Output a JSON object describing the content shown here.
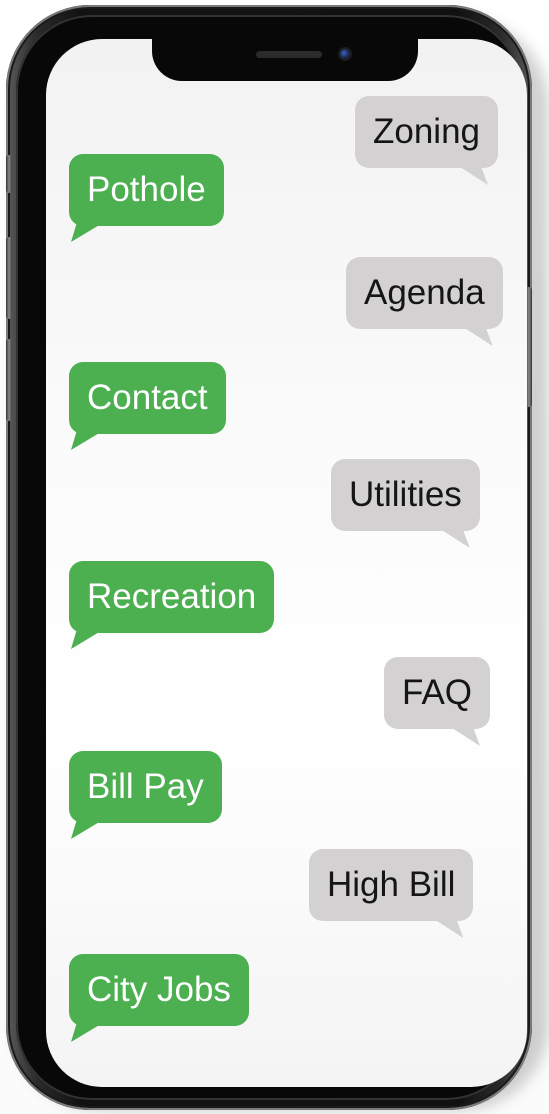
{
  "messages": {
    "zoning": "Zoning",
    "pothole": "Pothole",
    "agenda": "Agenda",
    "contact": "Contact",
    "utilities": "Utilities",
    "recreation": "Recreation",
    "faq": "FAQ",
    "bill_pay": "Bill Pay",
    "high_bill": "High Bill",
    "city_jobs": "City Jobs"
  },
  "colors": {
    "green_bubble": "#4caf50",
    "gray_bubble": "#d3d1d1",
    "phone_body": "#111111"
  }
}
